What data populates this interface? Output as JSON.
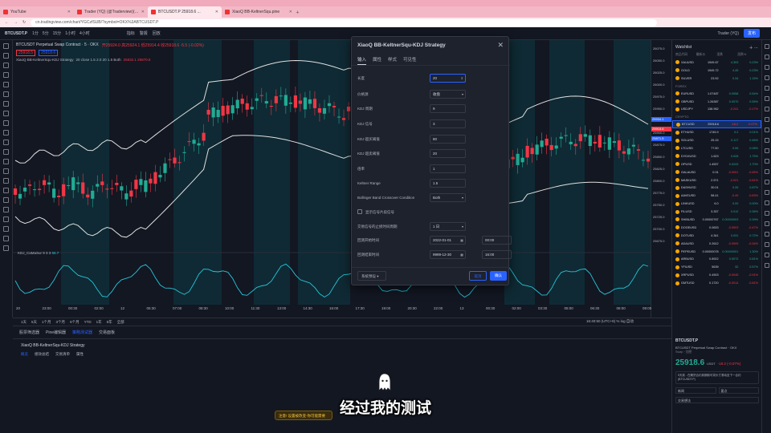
{
  "browser": {
    "tabs": [
      {
        "title": "YouTube",
        "active": false
      },
      {
        "title": "Trader (YQ) (@Traderview)(...)",
        "active": false
      },
      {
        "title": "BTCUSDT.P 25918.6 ...",
        "active": true
      },
      {
        "title": "XiaoQ BB-KeltnerSqu.pine",
        "active": false
      }
    ],
    "url": "cn.tradingview.com/chart/YGCzfSUB/?symbol=OKX%3ABTCUSDT.P"
  },
  "toolbar": {
    "symbol": "BTCUSDT.P",
    "intervals": [
      "1分",
      "5分",
      "15分",
      "1小时",
      "4小时"
    ],
    "indicators_label": "指标",
    "replay_label": "回放",
    "alert_label": "警报",
    "user": "Trader (YQ)",
    "publish": "发布"
  },
  "chart": {
    "header": "BTCUSDT Perpetual Swap Contract · 5 · OKX",
    "ohlc": "开25924.0 高25924.1 低25914.4 收25918.6 -5.5 (-0.02%)",
    "buy_price": "25918.6",
    "sell_price": "25918.5",
    "strategy_label": "XiaoQ BB-KeltnerSqu-KDJ Strategy",
    "strategy_params": "20 close 1.5 2.0 20 1.5 Both",
    "strategy_values": "25932.1  25870.5",
    "kdj_label": "KDJ_CaMaSur 9 3 3",
    "kdj_value": "55.7",
    "price_ticks": [
      "26075.0",
      "26050.0",
      "26025.0",
      "26000.0",
      "25975.0",
      "25950.0",
      "25925.0",
      "25900.0",
      "25875.0",
      "25850.0",
      "25825.0",
      "25800.0",
      "25775.0",
      "25750.0",
      "25725.0",
      "25700.0",
      "25675.0"
    ],
    "price_tags": [
      {
        "label": "25934.1",
        "color": "#2962ff"
      },
      {
        "label": "25918.6",
        "color": "#f23645"
      },
      {
        "label": "25871.5",
        "color": "#2962ff"
      }
    ],
    "time_ticks": [
      "20",
      "23:00",
      "00:30",
      "02:00",
      "12",
      "05:30",
      "07:00",
      "08:30",
      "10:00",
      "11:30",
      "13:00",
      "14:30",
      "16:00",
      "17:30",
      "19:00",
      "20:30",
      "22:00",
      "13",
      "00:30",
      "02:00",
      "03:30",
      "05:00",
      "06:30",
      "08:00",
      "09:00"
    ],
    "timeframes": [
      "1天",
      "5天",
      "1个月",
      "3个月",
      "6个月",
      "YTD",
      "1年",
      "5年",
      "全部"
    ],
    "tz": "16:40:50 (UTC+8)",
    "bottom_right": "%  log  自动"
  },
  "bottom_panel": {
    "tabs": [
      "股票筛选器",
      "Pine编辑器",
      "策略测试器",
      "交易面板"
    ],
    "active_tab": 2,
    "title": "XiaoQ BB-KeltnerSqu-KDJ Strategy",
    "subtabs": [
      "概览",
      "绩效总结",
      "交易清单",
      "属性"
    ]
  },
  "dialog": {
    "title": "XiaoQ BB-KeltnerSqu-KDJ Strategy",
    "tabs": [
      "输入",
      "属性",
      "样式",
      "可见性"
    ],
    "fields": [
      {
        "label": "长度",
        "value": "20",
        "type": "number",
        "focus": true
      },
      {
        "label": "价格源",
        "value": "收盘",
        "type": "select"
      },
      {
        "label": "KDJ 周期",
        "value": "9",
        "type": "number"
      },
      {
        "label": "KDJ 信号",
        "value": "3",
        "type": "number"
      },
      {
        "label": "KDJ 超买阈值",
        "value": "80",
        "type": "number"
      },
      {
        "label": "KDJ 超卖阈值",
        "value": "20",
        "type": "number"
      },
      {
        "label": "倍率",
        "value": "1",
        "type": "number"
      },
      {
        "label": "Keltner Range",
        "value": "1.5",
        "type": "number"
      },
      {
        "label": "Bollinger Band Crossover Condition",
        "value": "Both",
        "type": "select"
      },
      {
        "label": "显示信号片段信号",
        "value": "",
        "type": "checkbox"
      },
      {
        "label": "交易信号的止损时间周期",
        "value": "1 日",
        "type": "select"
      },
      {
        "label": "回测开始时间",
        "value": "2022-01-01",
        "value2": "00:00",
        "type": "datetime"
      },
      {
        "label": "回测结束时间",
        "value": "9999-12-30",
        "value2": "16:00",
        "type": "datetime"
      }
    ],
    "defaults_label": "系统预设",
    "cancel_label": "取消",
    "ok_label": "确认"
  },
  "watchlist": {
    "title": "Watchlist",
    "columns": [
      "商品代码",
      "最新价",
      "涨跌",
      "涨跌%"
    ],
    "sections": [
      {
        "name": "",
        "rows": [
          {
            "sym": "XAUUSD",
            "last": "1949.67",
            "chg": "4.393",
            "pct": "0.23%",
            "up": true
          },
          {
            "sym": "GOLD",
            "last": "1949.72",
            "chg": "4.45",
            "pct": "0.23%",
            "up": true
          },
          {
            "sym": "SILVER",
            "last": "23.92",
            "chg": "0.34",
            "pct": "1.15%",
            "up": true
          }
        ]
      },
      {
        "name": "FOREX",
        "rows": [
          {
            "sym": "EURUSD",
            "last": "1.07487",
            "chg": "0.0058",
            "pct": "0.54%",
            "up": true
          },
          {
            "sym": "GBPUSD",
            "last": "1.26387",
            "chg": "0.0070",
            "pct": "0.55%",
            "up": true
          },
          {
            "sym": "USDJPY",
            "last": "138.962",
            "chg": "-0.241",
            "pct": "-0.17%",
            "up": false
          }
        ]
      },
      {
        "name": "CRYPTO",
        "rows": [
          {
            "sym": "BTCUSD",
            "last": "25918.6",
            "chg": "-18.2",
            "pct": "-0.07%",
            "up": false,
            "sel": true
          },
          {
            "sym": "ETHUSD",
            "last": "1745.9",
            "chg": "0.2",
            "pct": "0.01%",
            "up": true
          },
          {
            "sym": "SOLUSD",
            "last": "25.15",
            "chg": "0.117",
            "pct": "0.46%",
            "up": true
          },
          {
            "sym": "LTCUSD",
            "last": "77.50",
            "chg": "0.06",
            "pct": "0.08%",
            "up": true
          },
          {
            "sym": "DYDXUSD",
            "last": "1.623",
            "chg": "0.028",
            "pct": "1.75%",
            "up": true
          },
          {
            "sym": "OPUSD",
            "last": "1.4537",
            "chg": "0.0243",
            "pct": "1.70%",
            "up": true
          },
          {
            "sym": "GALAUSD",
            "last": "0.01",
            "chg": "-0.0001",
            "pct": "-0.65%",
            "up": false
          },
          {
            "sym": "MASKUSD",
            "last": "2.571",
            "chg": "-0.021",
            "pct": "-0.81%",
            "up": false
          },
          {
            "sym": "DASHUSD",
            "last": "30.01",
            "chg": "0.26",
            "pct": "0.87%",
            "up": true
          },
          {
            "sym": "AAVEUSD",
            "last": "58.41",
            "chg": "-0.49",
            "pct": "-0.83%",
            "up": false
          },
          {
            "sym": "LINKUSD",
            "last": "6.0",
            "chg": "0.00",
            "pct": "0.00%",
            "up": true
          },
          {
            "sym": "FILUSD",
            "last": "3.337",
            "chg": "0.012",
            "pct": "0.36%",
            "up": true
          },
          {
            "sym": "SHIBUSD",
            "last": "0.00000767",
            "chg": "0.00000003",
            "pct": "0.39%",
            "up": true
          },
          {
            "sym": "DOGEUSD",
            "last": "0.0633",
            "chg": "-0.0003",
            "pct": "-0.47%",
            "up": false
          },
          {
            "sym": "DOTUSD",
            "last": "4.341",
            "chg": "0.031",
            "pct": "0.72%",
            "up": true
          },
          {
            "sym": "ADAUSD",
            "last": "0.2612",
            "chg": "-0.0009",
            "pct": "-0.34%",
            "up": false
          },
          {
            "sym": "PEPEUSD",
            "last": "0.00000078",
            "chg": "0.00000001",
            "pct": "1.30%",
            "up": true
          },
          {
            "sym": "ARBUSD",
            "last": "0.8922",
            "chg": "0.0072",
            "pct": "0.81%",
            "up": true
          },
          {
            "sym": "YFIUSD",
            "last": "5639",
            "chg": "32",
            "pct": "0.57%",
            "up": true
          },
          {
            "sym": "XRPUSD",
            "last": "0.4903",
            "chg": "-0.0045",
            "pct": "-0.91%",
            "up": false
          },
          {
            "sym": "GMTUSD",
            "last": "0.1720",
            "chg": "-0.0014",
            "pct": "-0.81%",
            "up": false
          }
        ]
      }
    ]
  },
  "detail": {
    "symbol": "BTCUSDT.P",
    "name": "BTCUSDT Perpetual Swap Contract · OKX",
    "sub": "Swap · 加密",
    "price": "25918.6",
    "unit": "USDT",
    "change": "-18.2 (-0.07%)",
    "note": "5天前 - 在期货合约到期前可将头寸滚动至下一合约 (BTCUSDT.P)",
    "btn1": "新闻",
    "btn2": "要点",
    "btn3": "交易想法"
  },
  "toast": "注意! 设置被改变-你可能需要",
  "subtitle": "经过我的测试",
  "colors": {
    "up": "#22ab94",
    "down": "#f23645",
    "accent": "#2962ff",
    "band": "#e0e0e0",
    "kdj": "#26c6da",
    "squeeze": "#0d3b44"
  }
}
